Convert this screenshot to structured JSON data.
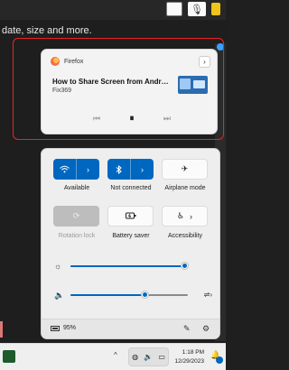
{
  "background": {
    "text": "date, size and more."
  },
  "media": {
    "app_name": "Firefox",
    "title": "How to Share Screen from Android...",
    "subtitle": "Fix369",
    "icons": {
      "expand": "chevron-right-icon",
      "previous": "skip-previous-icon",
      "play_pause": "pause-icon",
      "next": "skip-next-icon"
    }
  },
  "quick_settings": {
    "tiles": [
      {
        "label": "Available",
        "icon": "wifi-icon",
        "state": "on"
      },
      {
        "label": "Not connected",
        "icon": "bluetooth-icon",
        "state": "on"
      },
      {
        "label": "Airplane mode",
        "icon": "airplane-icon",
        "state": "off"
      },
      {
        "label": "Rotation lock",
        "icon": "rotation-lock-icon",
        "state": "disabled"
      },
      {
        "label": "Battery saver",
        "icon": "battery-saver-icon",
        "state": "off"
      },
      {
        "label": "Accessibility",
        "icon": "accessibility-icon",
        "state": "off"
      }
    ],
    "brightness_fraction": 0.98,
    "volume_fraction": 0.64,
    "battery_text": "95%"
  },
  "taskbar": {
    "time": "1:18 PM",
    "date": "12/29/2023"
  },
  "colors": {
    "accent": "#0067c0",
    "highlight": "#e22222"
  }
}
